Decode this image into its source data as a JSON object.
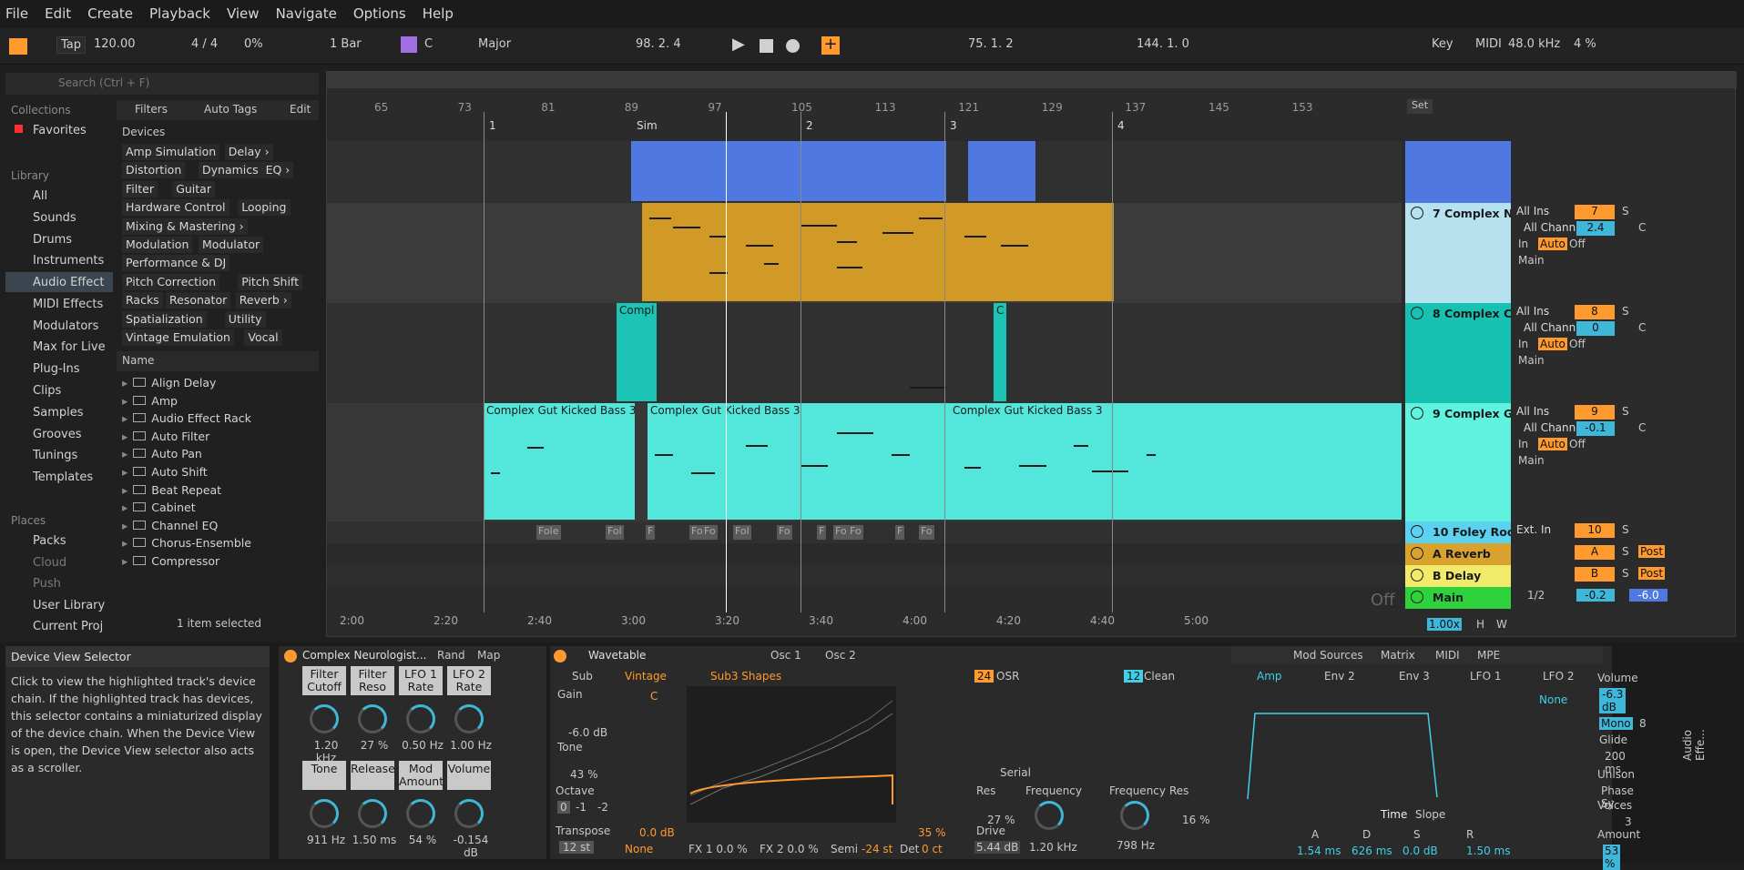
{
  "menu": [
    "File",
    "Edit",
    "Create",
    "Playback",
    "View",
    "Navigate",
    "Options",
    "Help"
  ],
  "transport": {
    "tap": "Tap",
    "tempo": "120.00",
    "signature": "4 / 4",
    "groove": "0%",
    "quantize": "1 Bar",
    "key": "C",
    "scale": "Major",
    "position": "98.  2.  4",
    "loop_start": "75.  1.  2",
    "loop_len": "144.  1.  0",
    "key_btn": "Key",
    "midi_btn": "MIDI",
    "sample_rate": "48.0 kHz",
    "cpu": "4 %"
  },
  "browser": {
    "search_placeholder": "Search (Ctrl + F)",
    "filters": "Filters",
    "auto_tags": "Auto Tags",
    "edit": "Edit",
    "collections_h": "Collections",
    "favorites": "Favorites",
    "library_h": "Library",
    "library": [
      "All",
      "Sounds",
      "Drums",
      "Instruments",
      "Audio Effect",
      "MIDI Effects",
      "Modulators",
      "Max for Live",
      "Plug-Ins",
      "Clips",
      "Samples",
      "Grooves",
      "Tunings",
      "Templates"
    ],
    "places_h": "Places",
    "places": [
      "Packs",
      "Cloud",
      "Push",
      "User Library",
      "Current Proj"
    ],
    "devices_h": "Devices",
    "tags": [
      [
        "Amp Simulation",
        "Delay ›"
      ],
      [
        "Distortion",
        "Dynamics",
        "EQ ›"
      ],
      [
        "Filter",
        "Guitar"
      ],
      [
        "Hardware Control",
        "Looping"
      ],
      [
        "Mixing & Mastering ›"
      ],
      [
        "Modulation",
        "Modulator"
      ],
      [
        "Performance & DJ"
      ],
      [
        "Pitch Correction",
        "Pitch Shift"
      ],
      [
        "Racks",
        "Resonator",
        "Reverb ›"
      ],
      [
        "Spatialization",
        "Utility"
      ],
      [
        "Vintage Emulation",
        "Vocal"
      ]
    ],
    "name_h": "Name",
    "items": [
      "Align Delay",
      "Amp",
      "Audio Effect Rack",
      "Auto Filter",
      "Auto Pan",
      "Auto Shift",
      "Beat Repeat",
      "Cabinet",
      "Channel EQ",
      "Chorus-Ensemble",
      "Compressor"
    ],
    "status": "1 item selected"
  },
  "arrangement": {
    "bars": [
      "65",
      "73",
      "81",
      "89",
      "97",
      "105",
      "113",
      "121",
      "129",
      "137",
      "145",
      "153"
    ],
    "set": "Set",
    "locators": [
      "1",
      "Sim",
      "2",
      "3",
      "4"
    ],
    "times": [
      "2:00",
      "2:20",
      "2:40",
      "3:00",
      "3:20",
      "3:40",
      "4:00",
      "4:20",
      "4:40",
      "5:00"
    ],
    "zoom": "1.00x",
    "h": "H",
    "w": "W",
    "off": "Off",
    "clip_bass": "Complex Gut Kicked Bass 3",
    "clip_bass_b": "Complex Gut Kicked Bass 3",
    "clip_bass_c": "Complex Gut Kicked Bass 3",
    "clip_cl": "Compl",
    "clip_cl2": "C",
    "foley": [
      "Fole",
      "Fol",
      "F",
      "Fo",
      "Fo",
      "Fol",
      "Fo",
      "F",
      "Fo",
      "Fo",
      "F",
      "Fo"
    ]
  },
  "tracks": [
    {
      "name": "7 Complex Ne",
      "num": "7",
      "input": "All Ins",
      "chan": "All Channe",
      "vol": "2.4",
      "pan": "C"
    },
    {
      "name": "8 Complex Cl",
      "num": "8",
      "input": "All Ins",
      "chan": "All Channe",
      "vol": "0",
      "pan": "C"
    },
    {
      "name": "9 Complex G",
      "num": "9",
      "input": "All Ins",
      "chan": "All Channe",
      "vol": "-0.1",
      "pan": "C"
    },
    {
      "name": "10 Foley Roo",
      "num": "10",
      "input": "Ext. In"
    },
    {
      "name": "A Reverb",
      "num": "A",
      "post": "Post"
    },
    {
      "name": "B Delay",
      "num": "B",
      "post": "Post"
    },
    {
      "name": "Main",
      "vol": "-0.2",
      "vol2": "-6.0",
      "split": "1/2"
    }
  ],
  "mixer": {
    "in": "In",
    "auto": "Auto",
    "off": "Off",
    "inf": "-∞",
    "main": "Main",
    "s": "S"
  },
  "info": {
    "title": "Device View Selector",
    "body": "Click to view the highlighted track's device chain. If the highlighted track has devices, this selector contains a miniaturized display of the device chain. When the Device View is open, the Device View selector also acts as a scroller."
  },
  "rack": {
    "name": "Complex Neurologist...",
    "rand": "Rand",
    "map": "Map",
    "macros": [
      {
        "label": "Filter Cutoff",
        "value": "1.20 kHz"
      },
      {
        "label": "Filter Reso",
        "value": "27 %"
      },
      {
        "label": "LFO 1 Rate",
        "value": "0.50 Hz"
      },
      {
        "label": "LFO 2 Rate",
        "value": "1.00 Hz"
      },
      {
        "label": "Tone",
        "value": "911 Hz"
      },
      {
        "label": "Release",
        "value": "1.50 ms"
      },
      {
        "label": "Mod Amount",
        "value": "54 %"
      },
      {
        "label": "Volume",
        "value": "-0.154 dB"
      }
    ]
  },
  "wavetable": {
    "title": "Wavetable",
    "osc1": "Osc 1",
    "osc2": "Osc 2",
    "sub": "Sub",
    "gain": "Gain",
    "gain_v": "-6.0 dB",
    "tone": "Tone",
    "tone_v": "43 %",
    "octave": "Octave",
    "oct": [
      "0",
      "-1",
      "-2"
    ],
    "transpose": "Transpose",
    "transpose_v": "12 st",
    "category": "Vintage",
    "table": "Sub3 Shapes",
    "c": "C",
    "level": "0.0 dB",
    "pct": "35 %",
    "none": "None",
    "fx1": "FX 1  0.0 %",
    "fx2": "FX 2  0.0 %",
    "semi": "Semi",
    "semi_v": "-24 st",
    "det": "Det",
    "det_v": "0 ct",
    "filter": {
      "f1": "24",
      "mode1": "OSR",
      "f2": "12",
      "mode2": "Clean",
      "serial": "Serial",
      "res": "Res",
      "res_v": "27 %",
      "drive": "Drive",
      "drive_v": "5.44 dB",
      "freq": "Frequency",
      "freq_v": "1.20 kHz",
      "freq2": "Frequency",
      "freq2_v": "798 Hz",
      "res2": "Res",
      "res2_v": "16 %"
    },
    "mod": {
      "sources": "Mod Sources",
      "matrix": "Matrix",
      "midi": "MIDI",
      "mpe": "MPE",
      "tabs": [
        "Amp",
        "Env 2",
        "Env 3",
        "LFO 1",
        "LFO 2"
      ],
      "none": "None",
      "time": "Time",
      "slope": "Slope",
      "a": "A",
      "d": "D",
      "s": "S",
      "r": "R",
      "a_v": "1.54 ms",
      "d_v": "626 ms",
      "s_v": "0.0 dB",
      "r_v": "1.50 ms"
    },
    "right": {
      "volume": "Volume",
      "volume_v": "-6.3 dB",
      "mono": "Mono",
      "voices8": "8",
      "glide": "Glide",
      "glide_v": "200 ms",
      "unison": "Unison",
      "unison_v": "Phase Sy",
      "voices": "Voices",
      "voices_v": "3",
      "amount": "Amount",
      "amount_v": "53 %",
      "audio_eff": "Audio Effe..."
    }
  }
}
